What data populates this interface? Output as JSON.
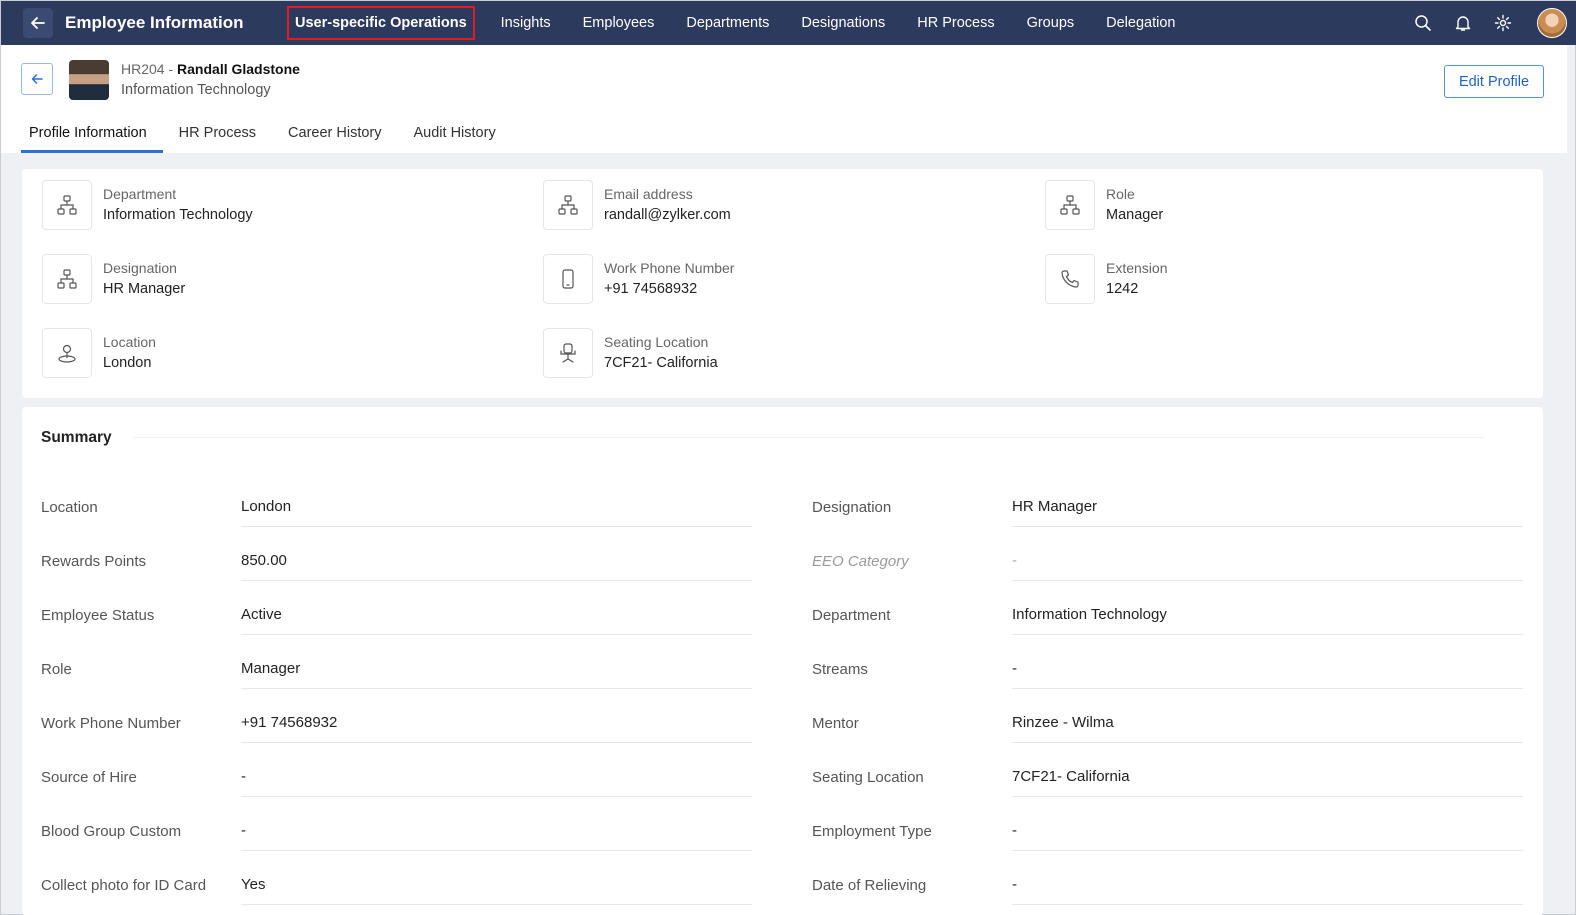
{
  "topbar": {
    "title": "Employee Information",
    "nav": [
      {
        "label": "User-specific Operations",
        "active": true
      },
      {
        "label": "Insights"
      },
      {
        "label": "Employees"
      },
      {
        "label": "Departments"
      },
      {
        "label": "Designations"
      },
      {
        "label": "HR Process"
      },
      {
        "label": "Groups"
      },
      {
        "label": "Delegation"
      }
    ],
    "icons": [
      "search-icon",
      "bell-icon",
      "gear-icon",
      "user-avatar"
    ],
    "highlight_color": "#e01b24",
    "bg_color": "#2c3a5e"
  },
  "employee": {
    "id": "HR204 -",
    "name": "Randall Gladstone",
    "department": "Information Technology",
    "edit_label": "Edit Profile"
  },
  "tabs": [
    {
      "label": "Profile Information",
      "active": true
    },
    {
      "label": "HR Process"
    },
    {
      "label": "Career History"
    },
    {
      "label": "Audit History"
    }
  ],
  "info": [
    {
      "label": "Department",
      "value": "Information Technology",
      "icon": "org-chart-icon"
    },
    {
      "label": "Email address",
      "value": "randall@zylker.com",
      "icon": "org-chart-icon"
    },
    {
      "label": "Role",
      "value": "Manager",
      "icon": "org-chart-icon"
    },
    {
      "label": "Designation",
      "value": "HR Manager",
      "icon": "org-chart-icon"
    },
    {
      "label": "Work Phone Number",
      "value": "+91 74568932",
      "icon": "mobile-phone-icon"
    },
    {
      "label": "Extension",
      "value": "1242",
      "icon": "phone-icon"
    },
    {
      "label": "Location",
      "value": "London",
      "icon": "location-pin-icon"
    },
    {
      "label": "Seating Location",
      "value": "7CF21- California",
      "icon": "chair-icon"
    }
  ],
  "summary": {
    "title": "Summary",
    "left": [
      {
        "label": "Location",
        "value": "London"
      },
      {
        "label": "Rewards Points",
        "value": "850.00"
      },
      {
        "label": "Employee Status",
        "value": "Active"
      },
      {
        "label": "Role",
        "value": "Manager"
      },
      {
        "label": "Work Phone Number",
        "value": "+91 74568932"
      },
      {
        "label": "Source of Hire",
        "value": "-"
      },
      {
        "label": "Blood Group Custom",
        "value": "-"
      },
      {
        "label": "Collect photo for ID Card",
        "value": "Yes"
      }
    ],
    "right": [
      {
        "label": "Designation",
        "value": "HR Manager"
      },
      {
        "label": "EEO Category",
        "value": "-"
      },
      {
        "label": "Department",
        "value": "Information Technology"
      },
      {
        "label": "Streams",
        "value": "-"
      },
      {
        "label": "Mentor",
        "value": "Rinzee - Wilma"
      },
      {
        "label": "Seating Location",
        "value": "7CF21- California"
      },
      {
        "label": "Employment Type",
        "value": "-"
      },
      {
        "label": "Date of Relieving",
        "value": "-"
      }
    ]
  }
}
